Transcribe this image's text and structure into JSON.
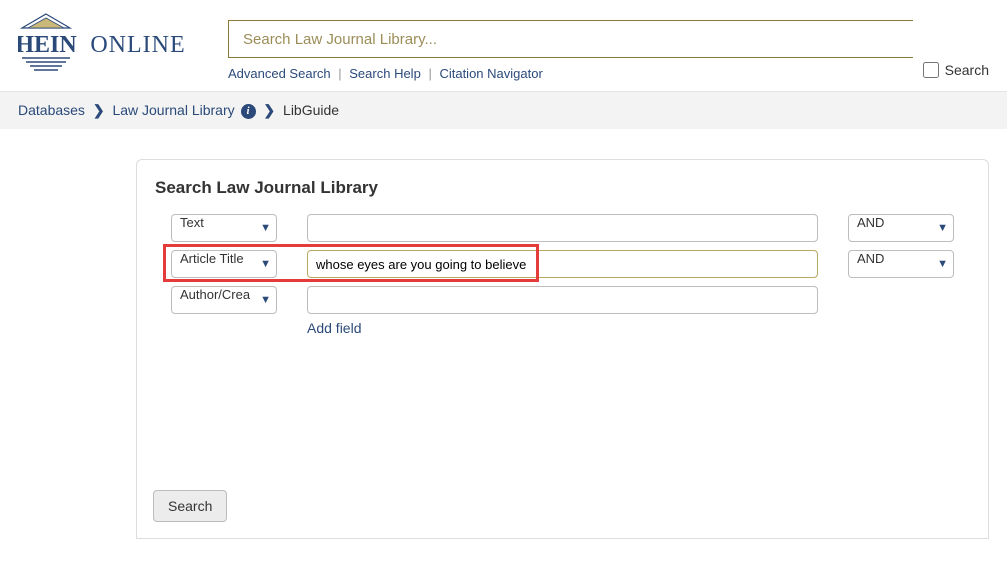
{
  "header": {
    "logo_top": "HEIN",
    "logo_bottom": "ONLINE",
    "search_placeholder": "Search Law Journal Library...",
    "links": {
      "advanced": "Advanced Search",
      "help": "Search Help",
      "citation": "Citation Navigator"
    },
    "search_all_label": "Search "
  },
  "breadcrumb": {
    "databases": "Databases",
    "library": "Law Journal Library",
    "current": "LibGuide"
  },
  "form": {
    "title": "Search Law Journal Library",
    "rows": [
      {
        "field": "Text",
        "value": "",
        "bool": "AND"
      },
      {
        "field": "Article Title",
        "value": "whose eyes are you going to believe",
        "bool": "AND"
      },
      {
        "field": "Author/Crea",
        "value": "",
        "bool": ""
      }
    ],
    "add_field": "Add field",
    "search_button": "Search"
  }
}
